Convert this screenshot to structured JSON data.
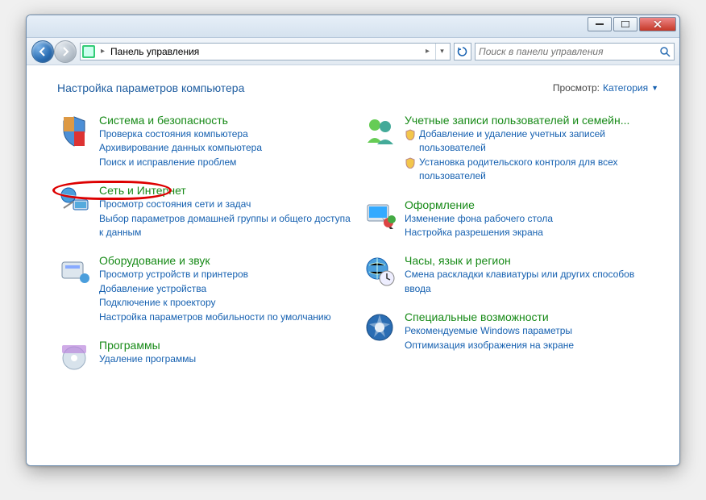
{
  "breadcrumb": {
    "root": "Панель управления"
  },
  "search": {
    "placeholder": "Поиск в панели управления"
  },
  "heading": "Настройка параметров компьютера",
  "viewby": {
    "label": "Просмотр:",
    "mode": "Категория"
  },
  "left": [
    {
      "title": "Система и безопасность",
      "links": [
        "Проверка состояния компьютера",
        "Архивирование данных компьютера",
        "Поиск и исправление проблем"
      ]
    },
    {
      "title": "Сеть и Интернет",
      "highlighted": true,
      "links": [
        "Просмотр состояния сети и задач",
        "Выбор параметров домашней группы и общего доступа к данным"
      ]
    },
    {
      "title": "Оборудование и звук",
      "links": [
        "Просмотр устройств и принтеров",
        "Добавление устройства",
        "Подключение к проектору",
        "Настройка параметров мобильности по умолчанию"
      ]
    },
    {
      "title": "Программы",
      "links": [
        "Удаление программы"
      ]
    }
  ],
  "right": [
    {
      "title": "Учетные записи пользователей и семейн...",
      "shield_links": [
        "Добавление и удаление учетных записей пользователей",
        "Установка родительского контроля для всех пользователей"
      ]
    },
    {
      "title": "Оформление",
      "links": [
        "Изменение фона рабочего стола",
        "Настройка разрешения экрана"
      ]
    },
    {
      "title": "Часы, язык и регион",
      "links": [
        "Смена раскладки клавиатуры или других способов ввода"
      ]
    },
    {
      "title": "Специальные возможности",
      "links": [
        "Рекомендуемые Windows параметры",
        "Оптимизация изображения на экране"
      ]
    }
  ]
}
